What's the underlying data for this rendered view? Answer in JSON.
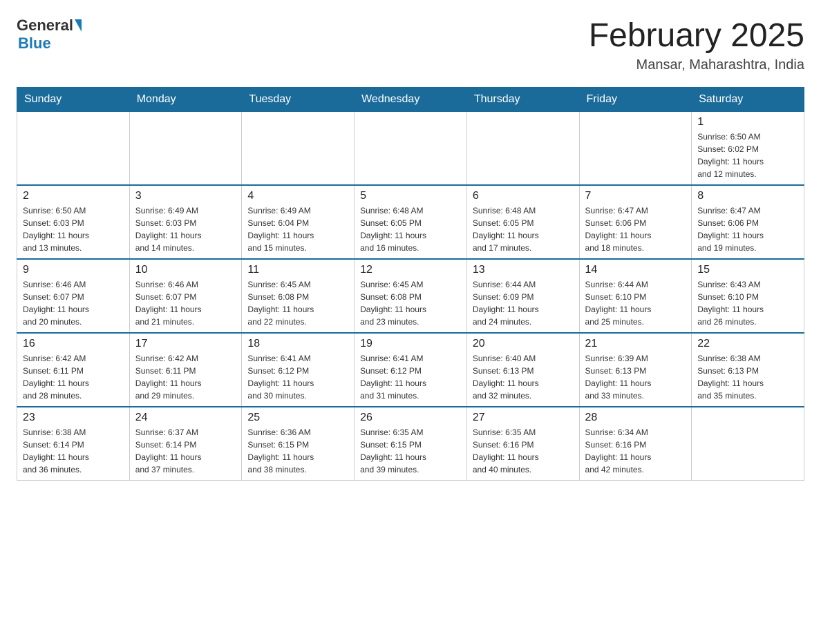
{
  "logo": {
    "general": "General",
    "blue": "Blue"
  },
  "title": "February 2025",
  "location": "Mansar, Maharashtra, India",
  "days_of_week": [
    "Sunday",
    "Monday",
    "Tuesday",
    "Wednesday",
    "Thursday",
    "Friday",
    "Saturday"
  ],
  "weeks": [
    [
      {
        "day": "",
        "info": ""
      },
      {
        "day": "",
        "info": ""
      },
      {
        "day": "",
        "info": ""
      },
      {
        "day": "",
        "info": ""
      },
      {
        "day": "",
        "info": ""
      },
      {
        "day": "",
        "info": ""
      },
      {
        "day": "1",
        "info": "Sunrise: 6:50 AM\nSunset: 6:02 PM\nDaylight: 11 hours\nand 12 minutes."
      }
    ],
    [
      {
        "day": "2",
        "info": "Sunrise: 6:50 AM\nSunset: 6:03 PM\nDaylight: 11 hours\nand 13 minutes."
      },
      {
        "day": "3",
        "info": "Sunrise: 6:49 AM\nSunset: 6:03 PM\nDaylight: 11 hours\nand 14 minutes."
      },
      {
        "day": "4",
        "info": "Sunrise: 6:49 AM\nSunset: 6:04 PM\nDaylight: 11 hours\nand 15 minutes."
      },
      {
        "day": "5",
        "info": "Sunrise: 6:48 AM\nSunset: 6:05 PM\nDaylight: 11 hours\nand 16 minutes."
      },
      {
        "day": "6",
        "info": "Sunrise: 6:48 AM\nSunset: 6:05 PM\nDaylight: 11 hours\nand 17 minutes."
      },
      {
        "day": "7",
        "info": "Sunrise: 6:47 AM\nSunset: 6:06 PM\nDaylight: 11 hours\nand 18 minutes."
      },
      {
        "day": "8",
        "info": "Sunrise: 6:47 AM\nSunset: 6:06 PM\nDaylight: 11 hours\nand 19 minutes."
      }
    ],
    [
      {
        "day": "9",
        "info": "Sunrise: 6:46 AM\nSunset: 6:07 PM\nDaylight: 11 hours\nand 20 minutes."
      },
      {
        "day": "10",
        "info": "Sunrise: 6:46 AM\nSunset: 6:07 PM\nDaylight: 11 hours\nand 21 minutes."
      },
      {
        "day": "11",
        "info": "Sunrise: 6:45 AM\nSunset: 6:08 PM\nDaylight: 11 hours\nand 22 minutes."
      },
      {
        "day": "12",
        "info": "Sunrise: 6:45 AM\nSunset: 6:08 PM\nDaylight: 11 hours\nand 23 minutes."
      },
      {
        "day": "13",
        "info": "Sunrise: 6:44 AM\nSunset: 6:09 PM\nDaylight: 11 hours\nand 24 minutes."
      },
      {
        "day": "14",
        "info": "Sunrise: 6:44 AM\nSunset: 6:10 PM\nDaylight: 11 hours\nand 25 minutes."
      },
      {
        "day": "15",
        "info": "Sunrise: 6:43 AM\nSunset: 6:10 PM\nDaylight: 11 hours\nand 26 minutes."
      }
    ],
    [
      {
        "day": "16",
        "info": "Sunrise: 6:42 AM\nSunset: 6:11 PM\nDaylight: 11 hours\nand 28 minutes."
      },
      {
        "day": "17",
        "info": "Sunrise: 6:42 AM\nSunset: 6:11 PM\nDaylight: 11 hours\nand 29 minutes."
      },
      {
        "day": "18",
        "info": "Sunrise: 6:41 AM\nSunset: 6:12 PM\nDaylight: 11 hours\nand 30 minutes."
      },
      {
        "day": "19",
        "info": "Sunrise: 6:41 AM\nSunset: 6:12 PM\nDaylight: 11 hours\nand 31 minutes."
      },
      {
        "day": "20",
        "info": "Sunrise: 6:40 AM\nSunset: 6:13 PM\nDaylight: 11 hours\nand 32 minutes."
      },
      {
        "day": "21",
        "info": "Sunrise: 6:39 AM\nSunset: 6:13 PM\nDaylight: 11 hours\nand 33 minutes."
      },
      {
        "day": "22",
        "info": "Sunrise: 6:38 AM\nSunset: 6:13 PM\nDaylight: 11 hours\nand 35 minutes."
      }
    ],
    [
      {
        "day": "23",
        "info": "Sunrise: 6:38 AM\nSunset: 6:14 PM\nDaylight: 11 hours\nand 36 minutes."
      },
      {
        "day": "24",
        "info": "Sunrise: 6:37 AM\nSunset: 6:14 PM\nDaylight: 11 hours\nand 37 minutes."
      },
      {
        "day": "25",
        "info": "Sunrise: 6:36 AM\nSunset: 6:15 PM\nDaylight: 11 hours\nand 38 minutes."
      },
      {
        "day": "26",
        "info": "Sunrise: 6:35 AM\nSunset: 6:15 PM\nDaylight: 11 hours\nand 39 minutes."
      },
      {
        "day": "27",
        "info": "Sunrise: 6:35 AM\nSunset: 6:16 PM\nDaylight: 11 hours\nand 40 minutes."
      },
      {
        "day": "28",
        "info": "Sunrise: 6:34 AM\nSunset: 6:16 PM\nDaylight: 11 hours\nand 42 minutes."
      },
      {
        "day": "",
        "info": ""
      }
    ]
  ]
}
